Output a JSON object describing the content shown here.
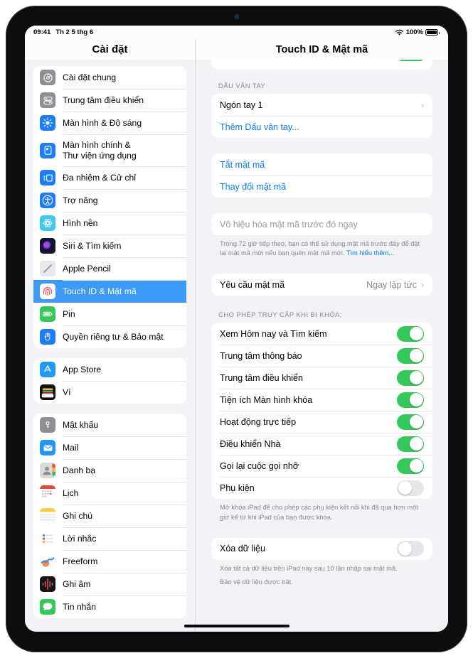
{
  "status_bar": {
    "time": "09:41",
    "date": "Th 2 5 thg 6",
    "battery_percent": "100%",
    "wifi_icon": "wifi-icon",
    "battery_icon": "battery-full-icon"
  },
  "sidebar": {
    "title": "Cài đặt",
    "groups": [
      {
        "items": [
          {
            "label": "Cài đặt chung",
            "icon": "gear-icon",
            "color": "#8e8e93",
            "selected": false
          },
          {
            "label": "Trung tâm điều khiển",
            "icon": "control-center-icon",
            "color": "#8e8e93",
            "selected": false
          },
          {
            "label": "Màn hình & Độ sáng",
            "icon": "brightness-icon",
            "color": "#1d7df7",
            "selected": false
          },
          {
            "label": "Màn hình chính &\nThư viện ứng dụng",
            "icon": "home-screen-icon",
            "color": "#1d7df7",
            "selected": false,
            "two_line": true
          },
          {
            "label": "Đa nhiệm & Cử chỉ",
            "icon": "multitasking-icon",
            "color": "#1d7df7",
            "selected": false
          },
          {
            "label": "Trợ năng",
            "icon": "accessibility-icon",
            "color": "#1d7df7",
            "selected": false
          },
          {
            "label": "Hình nền",
            "icon": "wallpaper-icon",
            "color": "#40c8f4",
            "selected": false
          },
          {
            "label": "Siri & Tìm kiếm",
            "icon": "siri-icon",
            "color": "#1a1a2e",
            "selected": false
          },
          {
            "label": "Apple Pencil",
            "icon": "pencil-icon",
            "color": "#8e8e93",
            "selected": false
          },
          {
            "label": "Touch ID & Mật mã",
            "icon": "fingerprint-icon",
            "color": "#fb4a5a",
            "selected": true
          },
          {
            "label": "Pin",
            "icon": "battery-icon",
            "color": "#34c759",
            "selected": false
          },
          {
            "label": "Quyền riêng tư & Bảo mật",
            "icon": "privacy-hand-icon",
            "color": "#1d7df7",
            "selected": false
          }
        ]
      },
      {
        "items": [
          {
            "label": "App Store",
            "icon": "app-store-icon",
            "color": "#1d9bf7",
            "selected": false
          },
          {
            "label": "Ví",
            "icon": "wallet-icon",
            "color": "#1c1c1e",
            "selected": false
          }
        ]
      },
      {
        "items": [
          {
            "label": "Mật khẩu",
            "icon": "key-icon",
            "color": "#8e8e93",
            "selected": false
          },
          {
            "label": "Mail",
            "icon": "mail-icon",
            "color": "#2196f3",
            "selected": false
          },
          {
            "label": "Danh bạ",
            "icon": "contacts-icon",
            "color": "#d8d8d4",
            "selected": false
          },
          {
            "label": "Lịch",
            "icon": "calendar-icon",
            "color": "#ffffff",
            "selected": false
          },
          {
            "label": "Ghi chú",
            "icon": "notes-icon",
            "color": "#ffffff",
            "selected": false
          },
          {
            "label": "Lời nhắc",
            "icon": "reminders-icon",
            "color": "#ffffff",
            "selected": false
          },
          {
            "label": "Freeform",
            "icon": "freeform-icon",
            "color": "#ffffff",
            "selected": false
          },
          {
            "label": "Ghi âm",
            "icon": "voice-memos-icon",
            "color": "#1c1c1e",
            "selected": false
          },
          {
            "label": "Tin nhắn",
            "icon": "messages-icon",
            "color": "#34c759",
            "selected": false
          }
        ]
      }
    ]
  },
  "main": {
    "title": "Touch ID & Mật mã",
    "fingerprint_section": {
      "header": "DẤU VÂN TAY",
      "finger_label": "Ngón tay 1",
      "add_label": "Thêm Dấu vân tay..."
    },
    "passcode_section": {
      "turn_off_label": "Tắt mật mã",
      "change_label": "Thay đổi mật mã"
    },
    "expire_section": {
      "label": "Vô hiệu hóa mật mã trước đó ngay",
      "footnote": "Trong 72 giờ tiếp theo, bạn có thể sử dụng mật mã trước đây để đặt lại mật mã mới nếu bạn quên mật mã mới. ",
      "footnote_link": "Tìm hiểu thêm..."
    },
    "require_section": {
      "label": "Yêu cầu mật mã",
      "value": "Ngay lập tức",
      "chevron": "chevron-right-icon"
    },
    "lock_access_section": {
      "header": "CHO PHÉP TRUY CẬP KHI BỊ KHÓA:",
      "rows": [
        {
          "label": "Xem Hôm nay và Tìm kiếm",
          "on": true
        },
        {
          "label": "Trung tâm thông báo",
          "on": true
        },
        {
          "label": "Trung tâm điều khiển",
          "on": true
        },
        {
          "label": "Tiện ích Màn hình khóa",
          "on": true
        },
        {
          "label": "Hoạt động trực tiếp",
          "on": true
        },
        {
          "label": "Điều khiển Nhà",
          "on": true
        },
        {
          "label": "Gọi lại cuộc gọi nhỡ",
          "on": true
        },
        {
          "label": "Phụ kiện",
          "on": false
        }
      ],
      "footnote": "Mở khóa iPad để cho phép các phụ kiện kết nối khi đã qua hơn một giờ kể từ khi iPad của bạn được khóa."
    },
    "erase_section": {
      "label": "Xóa dữ liệu",
      "on": false,
      "footnote1": "Xóa tất cả dữ liệu trên iPad này sau 10 lần nhập sai mật mã.",
      "footnote2": "Bảo vệ dữ liệu được bật."
    }
  },
  "colors": {
    "accent_blue": "#0a7bf7",
    "selected_blue": "#3d9bf7",
    "toggle_green": "#34c759",
    "toggle_off": "#e6e6eb"
  }
}
